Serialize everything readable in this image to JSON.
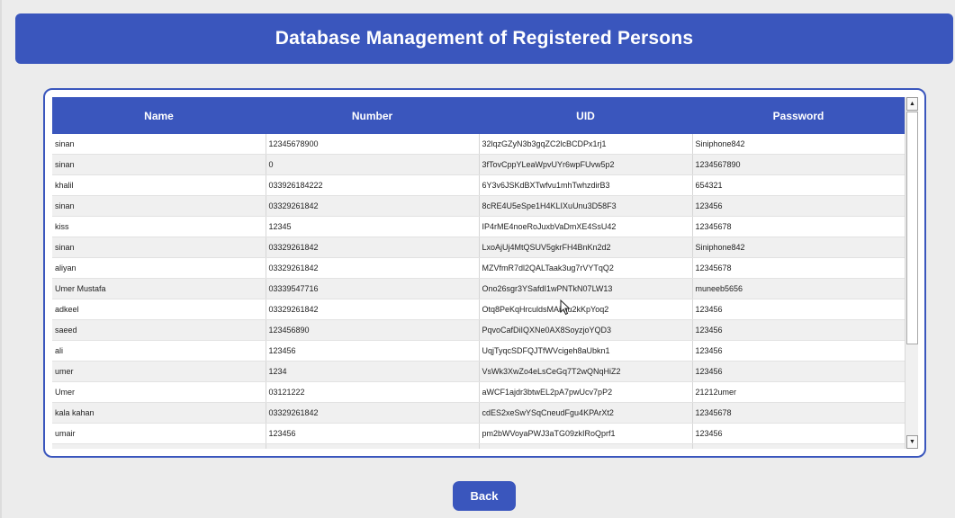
{
  "header": {
    "title": "Database Management of Registered Persons"
  },
  "table": {
    "columns": [
      "Name",
      "Number",
      "UID",
      "Password"
    ],
    "rows": [
      [
        "sinan",
        "12345678900",
        "32lqzGZyN3b3gqZC2lcBCDPx1rj1",
        "Siniphone842"
      ],
      [
        "sinan",
        "0",
        "3fTovCppYLeaWpvUYr6wpFUvw5p2",
        "1234567890"
      ],
      [
        "khalil",
        "033926184222",
        "6Y3v6JSKdBXTwfvu1mhTwhzdirB3",
        "654321"
      ],
      [
        "sinan",
        "03329261842",
        "8cRE4U5eSpe1H4KLIXuUnu3D58F3",
        "123456"
      ],
      [
        "kiss",
        "12345",
        "IP4rME4noeRoJuxbVaDmXE4SsU42",
        "12345678"
      ],
      [
        "sinan",
        "03329261842",
        "LxoAjUj4MtQSUV5gkrFH4BnKn2d2",
        "Siniphone842"
      ],
      [
        "aliyan",
        "03329261842",
        "MZVfmR7dl2QALTaak3ug7rVYTqQ2",
        "12345678"
      ],
      [
        "Umer Mustafa",
        "03339547716",
        "Ono26sgr3YSafdI1wPNTkN07LW13",
        "muneeb5656"
      ],
      [
        "adkeel",
        "03329261842",
        "Otq8PeKqHrculdsMAi hu2kKpYoq2",
        "123456"
      ],
      [
        "saeed",
        "123456890",
        "PqvoCafDiIQXNe0AX8SoyzjoYQD3",
        "123456"
      ],
      [
        "ali",
        "123456",
        "UqjTyqcSDFQJTfWVcigeh8aUbkn1",
        "123456"
      ],
      [
        "umer",
        "1234",
        "VsWk3XwZo4eLsCeGq7T2wQNqHiZ2",
        "123456"
      ],
      [
        "Umer",
        "03121222",
        "aWCF1ajdr3btwEL2pA7pwUcv7pP2",
        "21212umer"
      ],
      [
        "kala kahan",
        "03329261842",
        "cdES2xeSwYSqCneudFgu4KPArXt2",
        "12345678"
      ],
      [
        "umair",
        "123456",
        "pm2bWVoyaPWJ3aTG09zkIRoQprf1",
        "123456"
      ]
    ]
  },
  "scrollbar": {
    "up_glyph": "▲",
    "down_glyph": "▼"
  },
  "back_button": {
    "label": "Back"
  },
  "colors": {
    "accent": "#3a56bd",
    "row_alt": "#f0f0f0",
    "background": "#ececec"
  }
}
